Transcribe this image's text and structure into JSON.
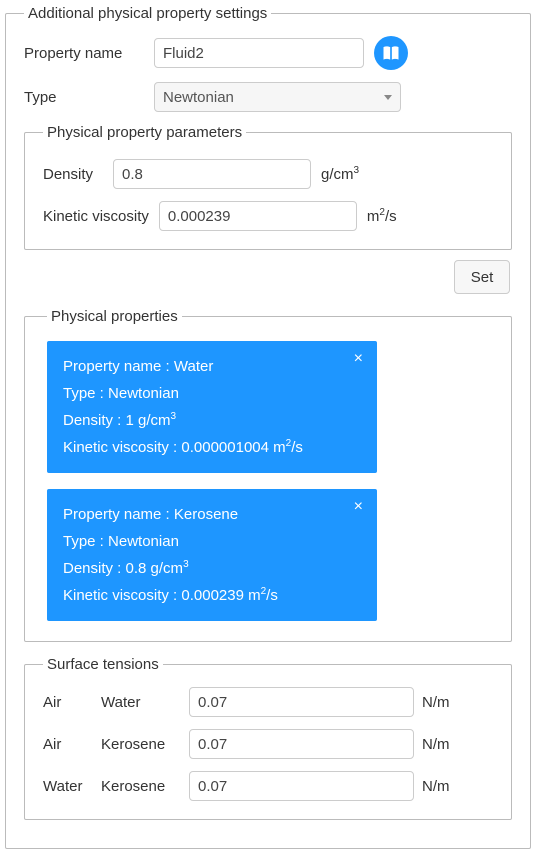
{
  "main": {
    "legend": "Additional physical property settings",
    "property_name_label": "Property name",
    "property_name_value": "Fluid2",
    "type_label": "Type",
    "type_value": "Newtonian"
  },
  "params": {
    "legend": "Physical property parameters",
    "density_label": "Density",
    "density_value": "0.8",
    "density_unit_html": "g/cm",
    "density_unit_sup": "3",
    "viscosity_label": "Kinetic viscosity",
    "viscosity_value": "0.000239",
    "viscosity_unit_html": "m",
    "viscosity_unit_sup": "2",
    "viscosity_unit_suffix": "/s"
  },
  "set_button": "Set",
  "properties": {
    "legend": "Physical properties",
    "cards": [
      {
        "name_label": "Property name : ",
        "name_value": "Water",
        "type_label": "Type : ",
        "type_value": "Newtonian",
        "density_label": "Density : ",
        "density_value": "1 g/cm",
        "density_sup": "3",
        "viscosity_label": "Kinetic viscosity : ",
        "viscosity_value": "0.000001004 m",
        "viscosity_sup": "2",
        "viscosity_suffix": "/s"
      },
      {
        "name_label": "Property name : ",
        "name_value": "Kerosene",
        "type_label": "Type : ",
        "type_value": "Newtonian",
        "density_label": "Density : ",
        "density_value": "0.8 g/cm",
        "density_sup": "3",
        "viscosity_label": "Kinetic viscosity : ",
        "viscosity_value": "0.000239 m",
        "viscosity_sup": "2",
        "viscosity_suffix": "/s"
      }
    ]
  },
  "tensions": {
    "legend": "Surface tensions",
    "unit": "N/m",
    "rows": [
      {
        "a": "Air",
        "b": "Water",
        "value": "0.07"
      },
      {
        "a": "Air",
        "b": "Kerosene",
        "value": "0.07"
      },
      {
        "a": "Water",
        "b": "Kerosene",
        "value": "0.07"
      }
    ]
  }
}
